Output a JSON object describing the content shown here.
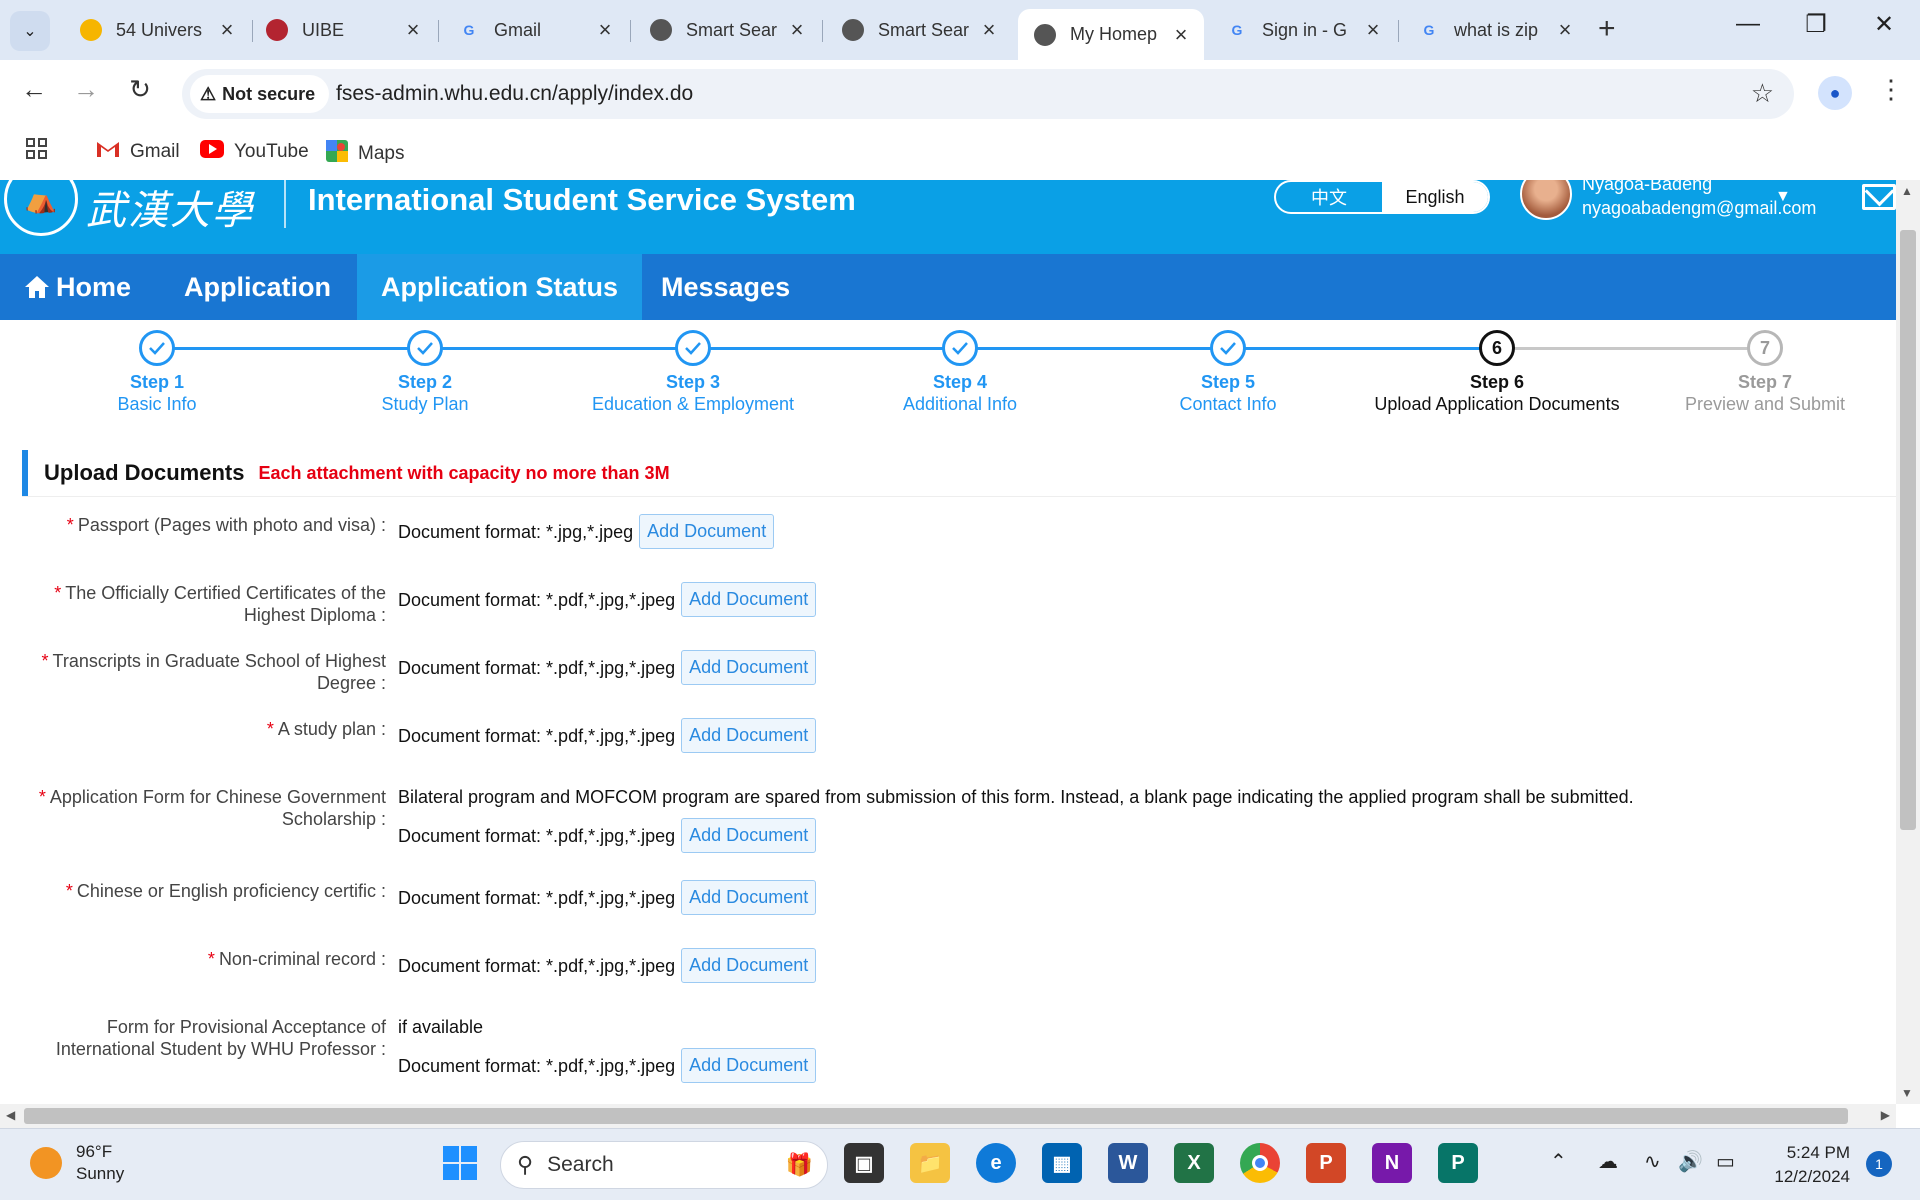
{
  "browser": {
    "tabs": [
      {
        "title": "54 Univers",
        "icon": "globe-yellow-icon"
      },
      {
        "title": "UIBE",
        "icon": "uibe-logo-icon"
      },
      {
        "title": "Gmail",
        "icon": "google-g-icon"
      },
      {
        "title": "Smart Sear",
        "icon": "globe-icon"
      },
      {
        "title": "Smart Sear",
        "icon": "globe-icon"
      },
      {
        "title": "My Homep",
        "icon": "globe-icon",
        "active": true
      },
      {
        "title": "Sign in - G",
        "icon": "google-g-icon"
      },
      {
        "title": "what is zip",
        "icon": "google-g-icon"
      }
    ],
    "security_label": "Not secure",
    "url": "fses-admin.whu.edu.cn/apply/index.do",
    "bookmarks": [
      {
        "label": "Gmail",
        "icon": "gmail-icon"
      },
      {
        "label": "YouTube",
        "icon": "youtube-icon"
      },
      {
        "label": "Maps",
        "icon": "maps-icon"
      }
    ]
  },
  "header": {
    "logo_text": "武漢大學",
    "system_title": "International Student Service System",
    "lang_cn": "中文",
    "lang_en": "English",
    "user_name": "Nyagoa-Badeng",
    "user_email": "nyagoabadengm@gmail.com"
  },
  "nav": {
    "home": "Home",
    "application": "Application",
    "status": "Application Status",
    "messages": "Messages"
  },
  "steps": [
    {
      "num": "1",
      "label": "Step 1",
      "sub": "Basic Info",
      "state": "done"
    },
    {
      "num": "2",
      "label": "Step 2",
      "sub": "Study Plan",
      "state": "done"
    },
    {
      "num": "3",
      "label": "Step 3",
      "sub": "Education & Employment",
      "state": "done"
    },
    {
      "num": "4",
      "label": "Step 4",
      "sub": "Additional Info",
      "state": "done"
    },
    {
      "num": "5",
      "label": "Step 5",
      "sub": "Contact Info",
      "state": "done"
    },
    {
      "num": "6",
      "label": "Step 6",
      "sub": "Upload Application Documents",
      "state": "current"
    },
    {
      "num": "7",
      "label": "Step 7",
      "sub": "Preview and Submit",
      "state": "todo"
    }
  ],
  "upload": {
    "title": "Upload Documents",
    "capacity_note": "Each attachment with capacity no more than 3M",
    "add_label": "Add Document",
    "docs": [
      {
        "label": "Passport (Pages with photo and visa)",
        "required": true,
        "note": "",
        "format": "Document format: *.jpg,*.jpeg"
      },
      {
        "label": "The Officially Certified Certificates of the Highest Diploma",
        "required": true,
        "note": "",
        "format": "Document format: *.pdf,*.jpg,*.jpeg"
      },
      {
        "label": "Transcripts in Graduate School of Highest Degree",
        "required": true,
        "note": "",
        "format": "Document format: *.pdf,*.jpg,*.jpeg"
      },
      {
        "label": "A study plan",
        "required": true,
        "note": "",
        "format": "Document format: *.pdf,*.jpg,*.jpeg"
      },
      {
        "label": "Application Form for Chinese Government Scholarship",
        "required": true,
        "note": "Bilateral program and MOFCOM program are spared from submission of this form. Instead, a blank page indicating the applied program shall be submitted.",
        "format": "Document format: *.pdf,*.jpg,*.jpeg"
      },
      {
        "label": "Chinese or English proficiency certific",
        "required": true,
        "note": "",
        "format": "Document format: *.pdf,*.jpg,*.jpeg"
      },
      {
        "label": "Non-criminal record",
        "required": true,
        "note": "",
        "format": "Document format: *.pdf,*.jpg,*.jpeg"
      },
      {
        "label": "Form for Provisional Acceptance of International Student by WHU Professor",
        "required": false,
        "note": "if available",
        "format": "Document format: *.pdf,*.jpg,*.jpeg"
      }
    ]
  },
  "taskbar": {
    "temp": "96°F",
    "condition": "Sunny",
    "search_placeholder": "Search",
    "time": "5:24 PM",
    "date": "12/2/2024",
    "notifications": "1"
  },
  "colors": {
    "header_bg": "#0aa0e6",
    "nav_bg": "#1976d2",
    "nav_active": "#1b9be6",
    "step_done": "#2196f3",
    "required": "#e60012"
  }
}
